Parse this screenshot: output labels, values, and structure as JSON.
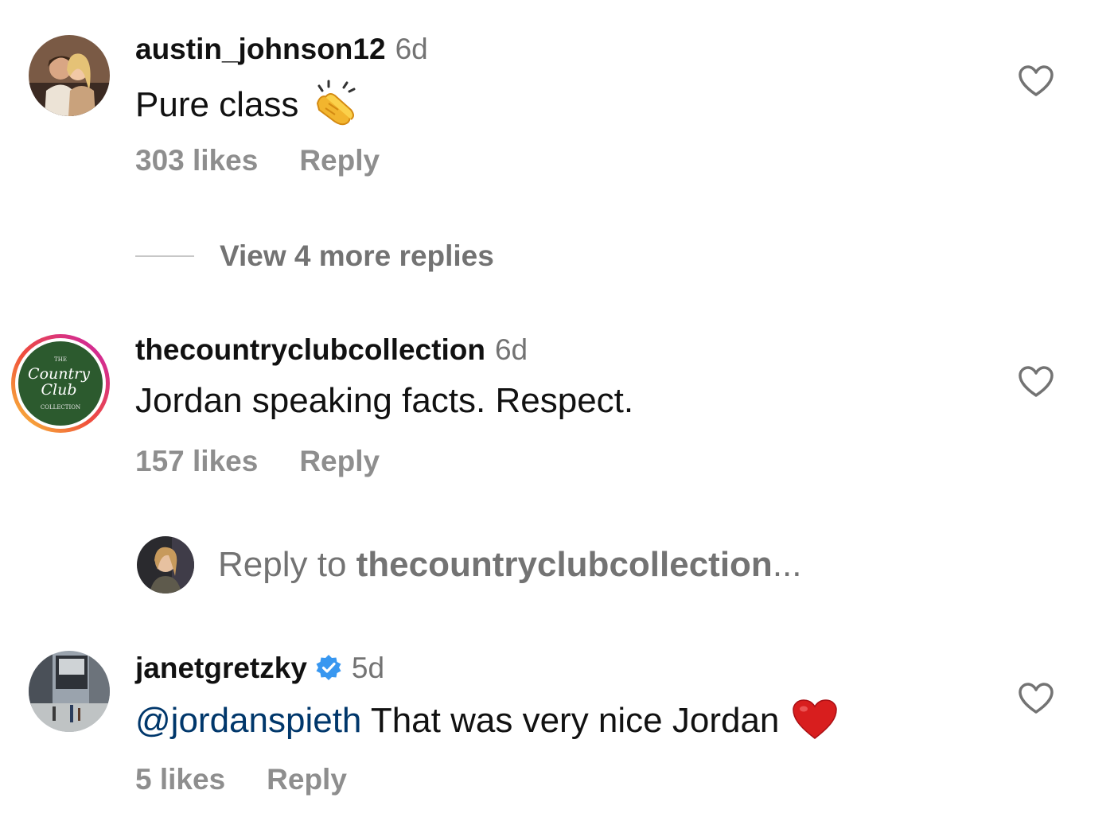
{
  "comments": [
    {
      "username": "austin_johnson12",
      "time": "6d",
      "text": "Pure class",
      "emoji": "clapping-hands",
      "likes": "303 likes",
      "reply_label": "Reply"
    },
    {
      "username": "thecountryclubcollection",
      "time": "6d",
      "text": "Jordan speaking facts. Respect.",
      "likes": "157 likes",
      "reply_label": "Reply",
      "avatar_logo": {
        "top": "THE",
        "line1": "Country",
        "line2": "Club",
        "bottom": "COLLECTION"
      }
    },
    {
      "username": "janetgretzky",
      "verified": true,
      "time": "5d",
      "mention": "@jordanspieth",
      "text": "That was very nice Jordan",
      "emoji": "red-heart",
      "likes": "5 likes",
      "reply_label": "Reply"
    }
  ],
  "view_more_replies": "View 4 more replies",
  "reply_input": {
    "prefix": "Reply to ",
    "target": "thecountryclubcollection",
    "suffix": "..."
  },
  "colors": {
    "text": "#111111",
    "secondary": "#737373",
    "meta": "#8e8e8e",
    "mention": "#00376b",
    "verified": "#3897f0"
  }
}
